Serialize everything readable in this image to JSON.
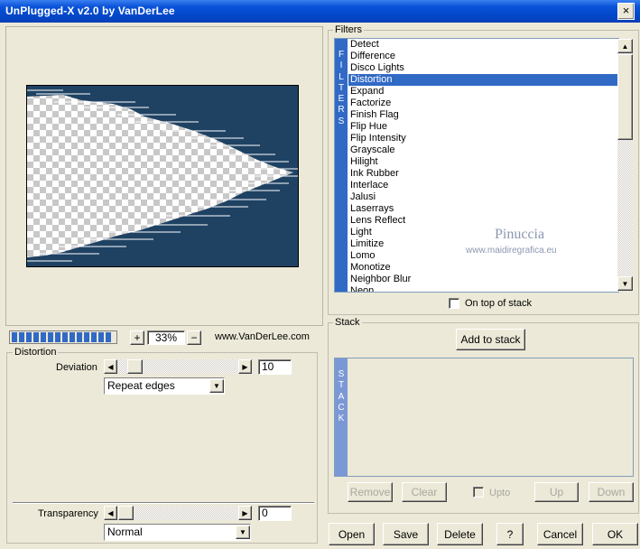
{
  "window": {
    "title": "UnPlugged-X v2.0 by VanDerLee",
    "close_label": "×"
  },
  "preview": {
    "zoom_value": "33%",
    "zoom_in_label": "+",
    "zoom_out_label": "−",
    "website": "www.VanDerLee.com",
    "progress_segments": 14
  },
  "distortion": {
    "group_label": "Distortion",
    "deviation_label": "Deviation",
    "deviation_value": "10",
    "edge_mode": "Repeat edges"
  },
  "transparency": {
    "label": "Transparency",
    "value": "0",
    "blend_mode": "Normal"
  },
  "filters": {
    "group_label": "Filters",
    "sidebar_text": "FILTERS",
    "items": [
      "Detect",
      "Difference",
      "Disco Lights",
      "Distortion",
      "Expand",
      "Factorize",
      "Finish Flag",
      "Flip Hue",
      "Flip Intensity",
      "Grayscale",
      "Hilight",
      "Ink Rubber",
      "Interlace",
      "Jalusi",
      "Laserrays",
      "Lens Reflect",
      "Light",
      "Limitize",
      "Lomo",
      "Monotize",
      "Neighbor Blur",
      "Neon"
    ],
    "selected": "Distortion",
    "on_top_label": "On top of stack"
  },
  "watermark": {
    "name": "Pinuccia",
    "url": "www.maidiregrafica.eu"
  },
  "stack": {
    "group_label": "Stack",
    "sidebar_text": "STACK",
    "add_label": "Add to stack",
    "remove_label": "Remove",
    "clear_label": "Clear",
    "upto_label": "Upto",
    "up_label": "Up",
    "down_label": "Down"
  },
  "buttons": {
    "open": "Open",
    "save": "Save",
    "delete": "Delete",
    "help": "?",
    "cancel": "Cancel",
    "ok": "OK"
  },
  "colors": {
    "accent": "#316ac5",
    "preview_bg": "#1f4263",
    "titlebar": "#0a52d8"
  }
}
